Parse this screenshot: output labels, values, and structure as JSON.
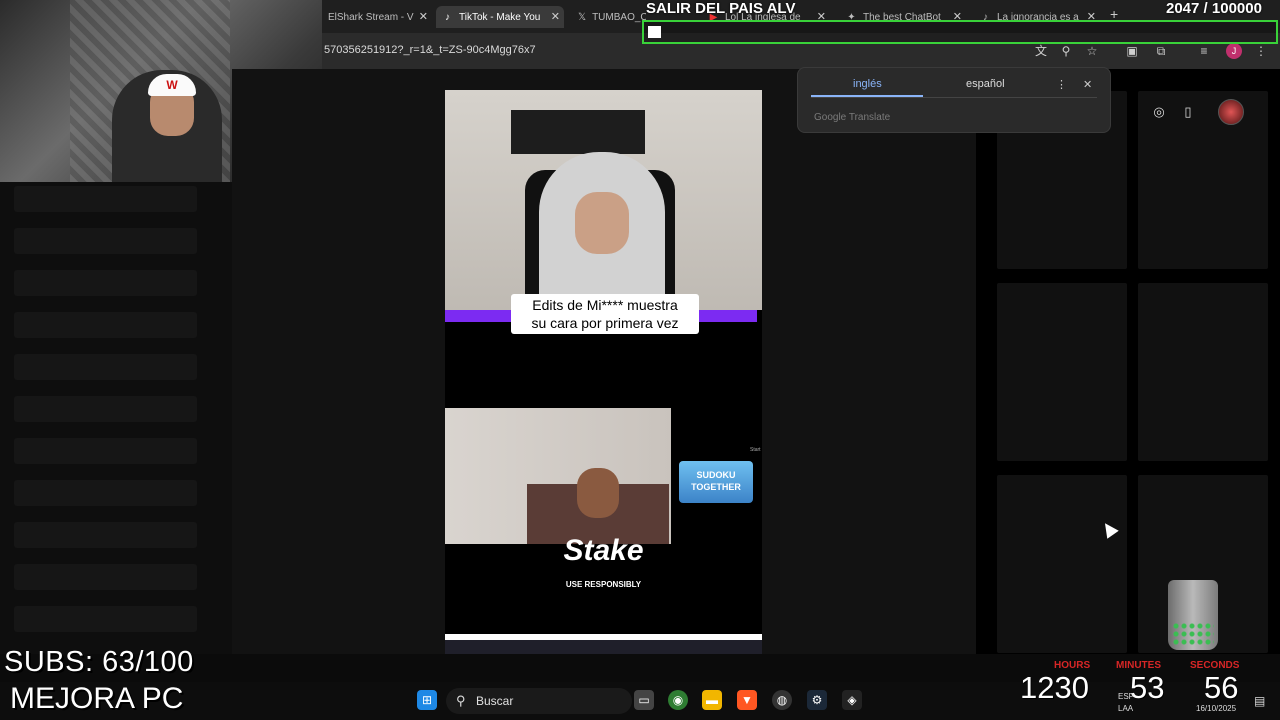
{
  "browser": {
    "tabs": [
      {
        "label": "ElShark Stream - V",
        "icon": "page-icon",
        "active": false
      },
      {
        "label": "TikTok - Make You",
        "icon": "tiktok-icon",
        "active": true
      },
      {
        "label": "TUMBAO_CH",
        "icon": "x-logo-icon",
        "active": false
      },
      {
        "label": "Lol La inglesa de",
        "icon": "youtube-icon",
        "active": false
      },
      {
        "label": "The best ChatBot",
        "icon": "chatbot-icon",
        "active": false
      },
      {
        "label": "La ignorancia es a",
        "icon": "tiktok-icon",
        "active": false
      }
    ],
    "url": "570356251912?_r=1&_t=ZS-90c4Mgg76x7",
    "profile_initial": "J"
  },
  "overlay": {
    "title": "SALIR DEL PAIS ALV",
    "goal_current": "2047",
    "goal_total": "/ 100000",
    "goal_progress": 0.02047,
    "goal_bar_color": "#39d239"
  },
  "translate_popup": {
    "lang_from": "inglés",
    "lang_to": "español",
    "provider": "Google Translate"
  },
  "video": {
    "caption_line1": "Edits de Mi**** muestra",
    "caption_line2": "su cara por primera vez",
    "game_tile": "SUDOKU TOGETHER",
    "start_text": "Start",
    "sponsor": "Stake",
    "sponsor_sub": "USE RESPONSIBLY",
    "accent_color": "#7c2bf2"
  },
  "stream_overlay": {
    "subs": "SUBS: 63/100",
    "mejora": "MEJORA PC",
    "timer": {
      "hours_label": "HOURS",
      "minutes_label": "MINUTES",
      "seconds_label": "SECONDS",
      "hours": "1230",
      "minutes": "53",
      "seconds": "56",
      "label_color": "#d72626"
    }
  },
  "taskbar": {
    "search_label": "Buscar",
    "lang_top": "ESP",
    "lang_bottom": "LAA",
    "date": "16/10/2025"
  }
}
